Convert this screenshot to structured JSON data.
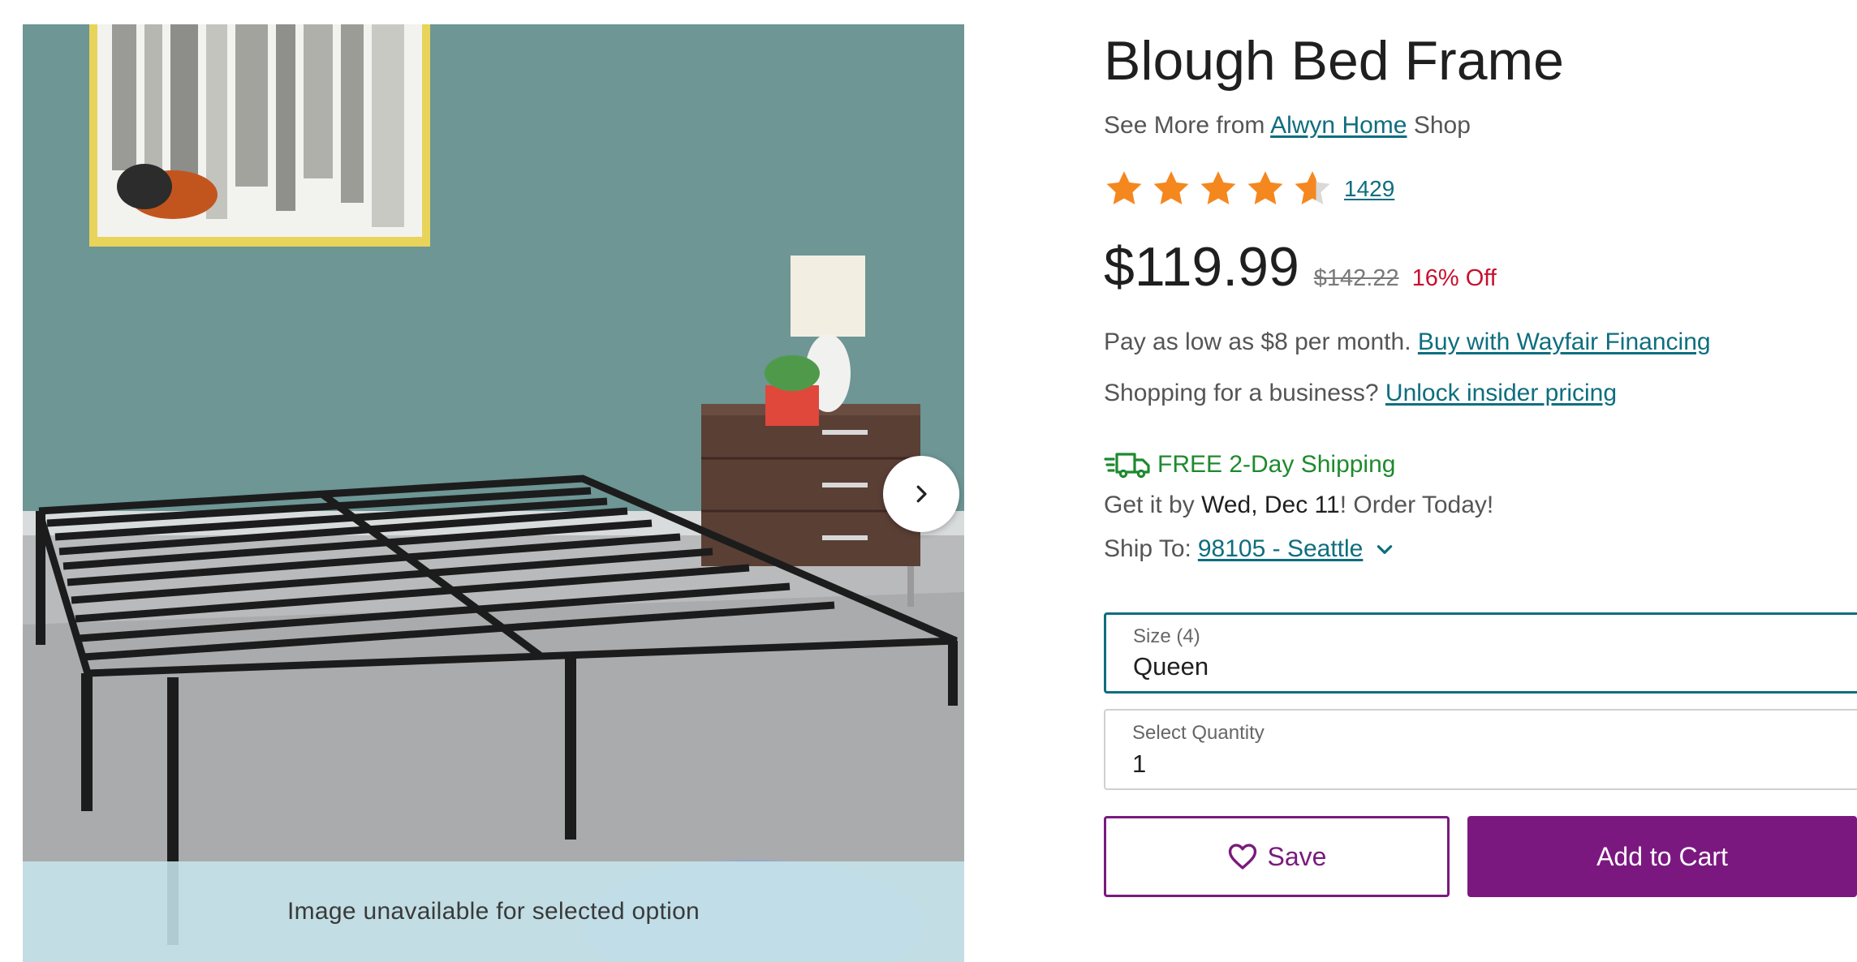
{
  "gallery": {
    "unavailable_text": "Image unavailable for selected option",
    "next_icon": "chevron-right-icon"
  },
  "product": {
    "title": "Blough Bed Frame",
    "brand_prefix": "See More from",
    "brand_name": "Alwyn Home",
    "brand_suffix": "Shop",
    "rating": 4.5,
    "review_count": "1429",
    "price": "$119.99",
    "old_price": "$142.22",
    "discount": "16% Off"
  },
  "financing": {
    "text": "Pay as low as $8 per month.",
    "link": "Buy with Wayfair Financing"
  },
  "business": {
    "text": "Shopping for a business?",
    "link": "Unlock insider pricing"
  },
  "shipping": {
    "label": "FREE 2-Day Shipping",
    "get_it_by": "Get it by",
    "date": "Wed, Dec 11",
    "order_today": "! Order Today!",
    "ship_to_label": "Ship To:",
    "ship_to_value": "98105 - Seattle"
  },
  "options": {
    "size_label": "Size (4)",
    "size_value": "Queen",
    "quantity_label": "Select Quantity",
    "quantity_value": "1"
  },
  "actions": {
    "save_label": "Save",
    "add_to_cart_label": "Add to Cart"
  },
  "colors": {
    "link": "#0e6e7e",
    "star": "#f5871f",
    "discount": "#c8102e",
    "shipping": "#1e8a2e",
    "brand_purple": "#7b1880"
  }
}
